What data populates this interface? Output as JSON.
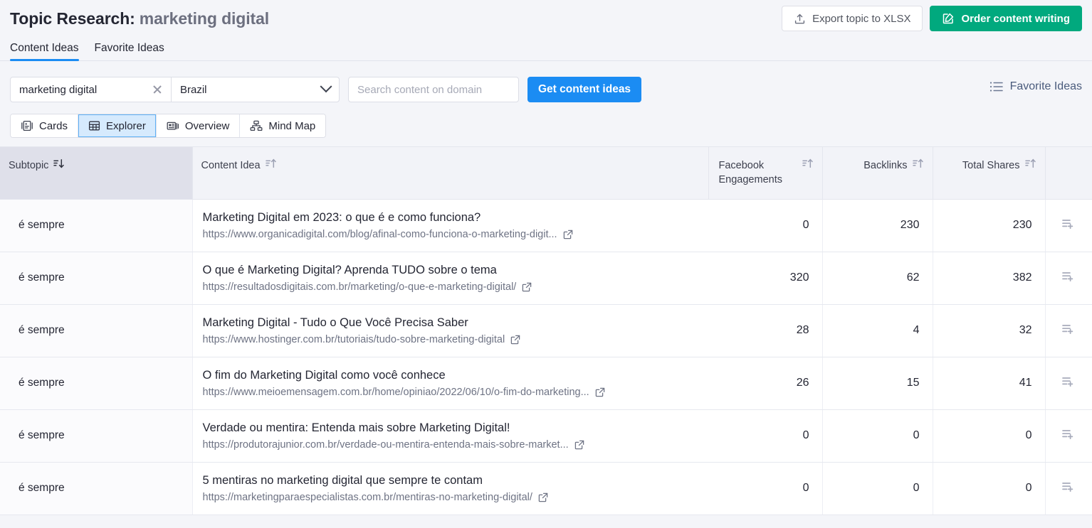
{
  "header": {
    "title_prefix": "Topic Research:",
    "topic": "marketing digital",
    "export_label": "Export topic to XLSX",
    "order_label": "Order content writing",
    "export_icon": "upload-icon",
    "order_icon": "edit-square-icon"
  },
  "tabs": [
    {
      "label": "Content Ideas",
      "active": true
    },
    {
      "label": "Favorite Ideas",
      "active": false
    }
  ],
  "controls": {
    "keyword_value": "marketing digital",
    "clear_icon": "close-icon",
    "country_value": "Brazil",
    "country_options": [
      "Brazil"
    ],
    "chevron_icon": "chevron-down-icon",
    "domain_placeholder": "Search content on domain",
    "domain_value": "",
    "get_ideas_label": "Get content ideas",
    "favorite_ideas_label": "Favorite Ideas",
    "favorite_ideas_icon": "list-icon"
  },
  "views": [
    {
      "label": "Cards",
      "icon": "cards-icon",
      "selected": false
    },
    {
      "label": "Explorer",
      "icon": "table-icon",
      "selected": true
    },
    {
      "label": "Overview",
      "icon": "overview-icon",
      "selected": false
    },
    {
      "label": "Mind Map",
      "icon": "mindmap-icon",
      "selected": false
    }
  ],
  "table": {
    "columns": [
      {
        "key": "subtopic",
        "label": "Subtopic",
        "sorted": true,
        "sort_dir": "desc",
        "align": "left"
      },
      {
        "key": "idea",
        "label": "Content Idea",
        "sorted": false,
        "sort_dir": "asc",
        "align": "left"
      },
      {
        "key": "fb",
        "label": "Facebook Engagements",
        "sorted": false,
        "sort_dir": "asc",
        "align": "right"
      },
      {
        "key": "bl",
        "label": "Backlinks",
        "sorted": false,
        "sort_dir": "asc",
        "align": "right"
      },
      {
        "key": "ts",
        "label": "Total Shares",
        "sorted": false,
        "sort_dir": "asc",
        "align": "right"
      }
    ],
    "action_icon": "add-to-list-icon",
    "external_link_icon": "external-link-icon",
    "rows": [
      {
        "subtopic": "é sempre",
        "title": "Marketing Digital em 2023: o que é e como funciona?",
        "url": "https://www.organicadigital.com/blog/afinal-como-funciona-o-marketing-digit...",
        "fb": "0",
        "bl": "230",
        "ts": "230"
      },
      {
        "subtopic": "é sempre",
        "title": "O que é Marketing Digital? Aprenda TUDO sobre o tema",
        "url": "https://resultadosdigitais.com.br/marketing/o-que-e-marketing-digital/",
        "fb": "320",
        "bl": "62",
        "ts": "382"
      },
      {
        "subtopic": "é sempre",
        "title": "Marketing Digital - Tudo o Que Você Precisa Saber",
        "url": "https://www.hostinger.com.br/tutoriais/tudo-sobre-marketing-digital",
        "fb": "28",
        "bl": "4",
        "ts": "32"
      },
      {
        "subtopic": "é sempre",
        "title": "O fim do Marketing Digital como você conhece",
        "url": "https://www.meioemensagem.com.br/home/opiniao/2022/06/10/o-fim-do-marketing...",
        "fb": "26",
        "bl": "15",
        "ts": "41"
      },
      {
        "subtopic": "é sempre",
        "title": "Verdade ou mentira: Entenda mais sobre Marketing Digital!",
        "url": "https://produtorajunior.com.br/verdade-ou-mentira-entenda-mais-sobre-market...",
        "fb": "0",
        "bl": "0",
        "ts": "0"
      },
      {
        "subtopic": "é sempre",
        "title": "5 mentiras no marketing digital que sempre te contam",
        "url": "https://marketingparaespecialistas.com.br/mentiras-no-marketing-digital/",
        "fb": "0",
        "bl": "0",
        "ts": "0"
      }
    ]
  },
  "colors": {
    "accent_blue": "#1b8cf3",
    "accent_green": "#01a97e",
    "header_sorted_bg": "#dfe0ea",
    "header_bg": "#f2f3f8",
    "page_bg": "#f4f5f9"
  }
}
